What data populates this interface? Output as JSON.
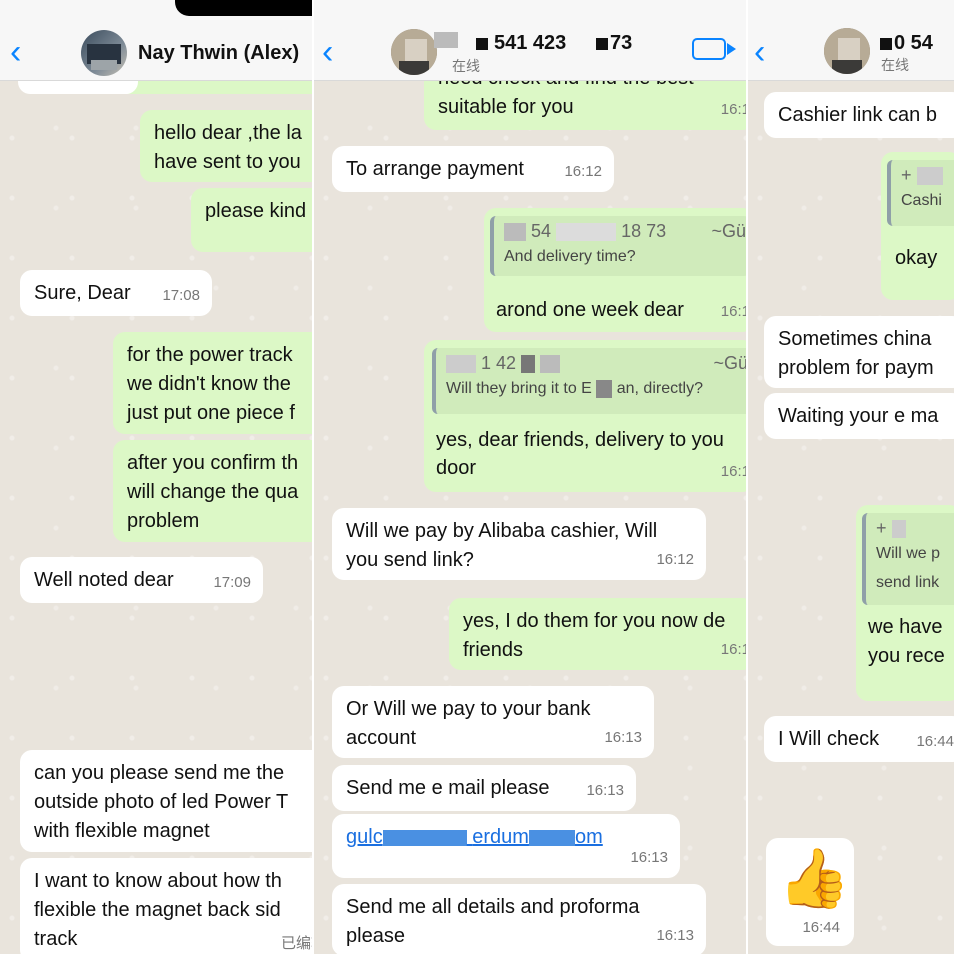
{
  "panel1": {
    "contact_name": "Nay Thwin (Alex)",
    "messages": {
      "m1": {
        "text1": "hello dear ,the la",
        "text2": "have sent to you"
      },
      "m2": {
        "text": "please kind"
      },
      "m3": {
        "text": "Sure, Dear",
        "time": "17:08"
      },
      "m4": {
        "text1": "for the power track",
        "text2": "we didn't know the",
        "text3": "just put one piece f"
      },
      "m5": {
        "text1": "after you confirm th",
        "text2": "will change the qua",
        "text3": "problem"
      },
      "m6": {
        "text": "Well noted dear",
        "time": "17:09"
      },
      "m7": {
        "text1": "can you please send me the",
        "text2": "outside photo of led Power T",
        "text3": "with flexible magnet"
      },
      "m8": {
        "text1": "I want to know about how th",
        "text2": "flexible the magnet back sid",
        "text3": "track",
        "edited": "已编辑"
      }
    }
  },
  "panel2": {
    "contact_name": "541 423",
    "contact_name_tail": "73",
    "status": "在线",
    "messages": {
      "m1": {
        "text1": "need check and find the best",
        "text2": "suitable for you",
        "time": "16:1"
      },
      "m2": {
        "text": "To arrange payment",
        "time": "16:12"
      },
      "m3": {
        "quote_name": "54",
        "quote_name_tail": "18 73",
        "quote_tag": "~Gü",
        "quote_text": "And delivery time?",
        "text": "arond one week dear",
        "time": "16:1"
      },
      "m4": {
        "quote_name": "1 42",
        "quote_tag": "~Gü",
        "quote_text1": "Will they bring it to E",
        "quote_text2": "an, directly?",
        "text1": "yes, dear friends, delivery to you",
        "text2": "door",
        "time": "16:1"
      },
      "m5": {
        "text1": "Will we pay by Alibaba cashier, Will",
        "text2": "you send link?",
        "time": "16:12"
      },
      "m6": {
        "text1": "yes, I do them for you now de",
        "text2": "friends",
        "time": "16:1"
      },
      "m7": {
        "text1": "Or Will we pay to your bank",
        "text2": "account",
        "time": "16:13"
      },
      "m8": {
        "text": "Send me e mail please",
        "time": "16:13"
      },
      "m9": {
        "link1": "gulc",
        "link2": "erdum",
        "link3": "om",
        "time": "16:13"
      },
      "m10": {
        "text1": "Send me all details and proforma",
        "text2": "please",
        "time": "16:13"
      }
    }
  },
  "panel3": {
    "contact_name": "0 54",
    "status": "在线",
    "messages": {
      "m1": {
        "text": "Cashier link can b"
      },
      "m2": {
        "quote_name": "+",
        "quote_text": "Cashi",
        "text": "okay"
      },
      "m3": {
        "text1": "Sometimes china",
        "text2": "problem for paym"
      },
      "m4": {
        "text": "Waiting your e ma"
      },
      "m5": {
        "quote_name": "+",
        "quote_text1": "Will we p",
        "quote_text2": "send link",
        "text1": "we have",
        "text2": "you rece"
      },
      "m6": {
        "text": "I Will check",
        "time": "16:44"
      },
      "m7": {
        "emoji": "👍",
        "time": "16:44"
      }
    }
  },
  "colors": {
    "incoming": "#ffffff",
    "outgoing": "#dcf8c6",
    "accent": "#0a84ff",
    "link": "#1a6fe0"
  },
  "icons": [
    "back-chevron-icon",
    "video-call-icon",
    "thumbs-up-emoji"
  ]
}
